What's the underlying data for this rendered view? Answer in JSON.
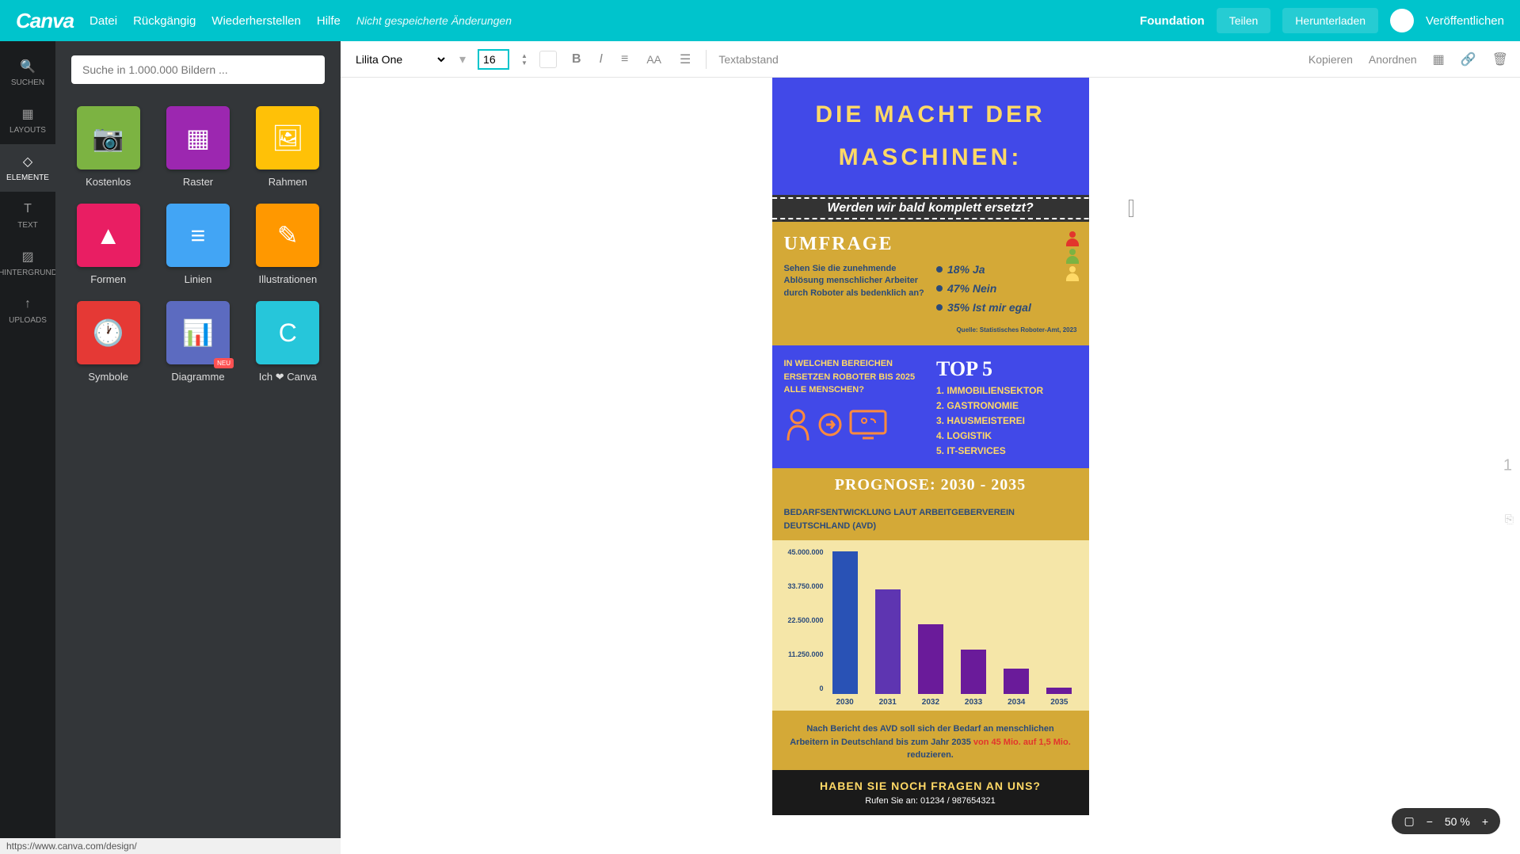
{
  "topbar": {
    "logo": "Canva",
    "menu": [
      "Datei",
      "Rückgängig",
      "Wiederherstellen",
      "Hilfe"
    ],
    "status": "Nicht gespeicherte Änderungen",
    "foundation": "Foundation",
    "share": "Teilen",
    "download": "Herunterladen",
    "publish": "Veröffentlichen"
  },
  "nav": {
    "items": [
      {
        "label": "SUCHEN",
        "icon": "🔍"
      },
      {
        "label": "LAYOUTS",
        "icon": "▦"
      },
      {
        "label": "ELEMENTE",
        "icon": "◇"
      },
      {
        "label": "TEXT",
        "icon": "T"
      },
      {
        "label": "HINTERGRUND",
        "icon": "▨"
      },
      {
        "label": "UPLOADS",
        "icon": "↑"
      }
    ],
    "active": 2
  },
  "panel": {
    "search_placeholder": "Suche in 1.000.000 Bildern ...",
    "tiles": [
      {
        "label": "Kostenlos",
        "color": "#7cb342",
        "icon": "📷"
      },
      {
        "label": "Raster",
        "color": "#9c27b0",
        "icon": "▦"
      },
      {
        "label": "Rahmen",
        "color": "#ffc107",
        "icon": "🖼"
      },
      {
        "label": "Formen",
        "color": "#e91e63",
        "icon": "▲"
      },
      {
        "label": "Linien",
        "color": "#42a5f5",
        "icon": "≡"
      },
      {
        "label": "Illustrationen",
        "color": "#ff9800",
        "icon": "✎"
      },
      {
        "label": "Symbole",
        "color": "#e53935",
        "icon": "🕐"
      },
      {
        "label": "Diagramme",
        "color": "#5c6bc0",
        "icon": "📊",
        "badge": "NEU"
      },
      {
        "label": "Ich ❤ Canva",
        "color": "#26c6da",
        "icon": "C"
      }
    ]
  },
  "toolbar": {
    "font": "Lilita One",
    "size": "16",
    "spacing": "Textabstand",
    "copy": "Kopieren",
    "arrange": "Anordnen"
  },
  "design": {
    "header": "DIE MACHT DER MASCHINEN:",
    "subheader": "Werden wir bald komplett ersetzt?",
    "umfrage": {
      "title": "UMFRAGE",
      "question": "Sehen Sie die zunehmende Ablösung menschlicher Arbeiter durch Roboter als bedenklich an?",
      "stats": [
        "18% Ja",
        "47% Nein",
        "35% Ist mir egal"
      ],
      "quelle": "Quelle: Statistisches Roboter-Amt, 2023"
    },
    "top5": {
      "question": "IN WELCHEN BEREICHEN ERSETZEN ROBOTER BIS  2025 ALLE MENSCHEN?",
      "title": "TOP 5",
      "items": [
        "1. IMMOBILIENSEKTOR",
        "2. GASTRONOMIE",
        "3. HAUSMEISTEREI",
        "4. LOGISTIK",
        "5. IT-SERVICES"
      ]
    },
    "prognose": {
      "title": "PROGNOSE: 2030 - 2035",
      "sub": "BEDARFSENTWICKLUNG LAUT ARBEITGEBERVEREIN DEUTSCHLAND (AVD)",
      "text1": "Nach Bericht des AVD soll sich der Bedarf an menschlichen Arbeitern in Deutschland bis zum Jahr 2035",
      "highlight": "von 45 Mio. auf 1,5 Mio.",
      "text2": " reduzieren."
    },
    "footer": {
      "title": "HABEN SIE NOCH FRAGEN AN UNS?",
      "sub": "Rufen Sie an: 01234 / 987654321"
    }
  },
  "chart_data": {
    "type": "bar",
    "categories": [
      "2030",
      "2031",
      "2032",
      "2033",
      "2034",
      "2035"
    ],
    "values": [
      45000000,
      33000000,
      22000000,
      14000000,
      8000000,
      2000000
    ],
    "colors": [
      "#2952b5",
      "#5e35b1",
      "#6a1b9a",
      "#6a1b9a",
      "#6a1b9a",
      "#6a1b9a"
    ],
    "ylabels": [
      "45.000.000",
      "33.750.000",
      "22.500.000",
      "11.250.000",
      "0"
    ],
    "ylim": [
      0,
      45000000
    ]
  },
  "zoom": "50 %",
  "page": "1",
  "statusbar_url": "https://www.canva.com/design/"
}
